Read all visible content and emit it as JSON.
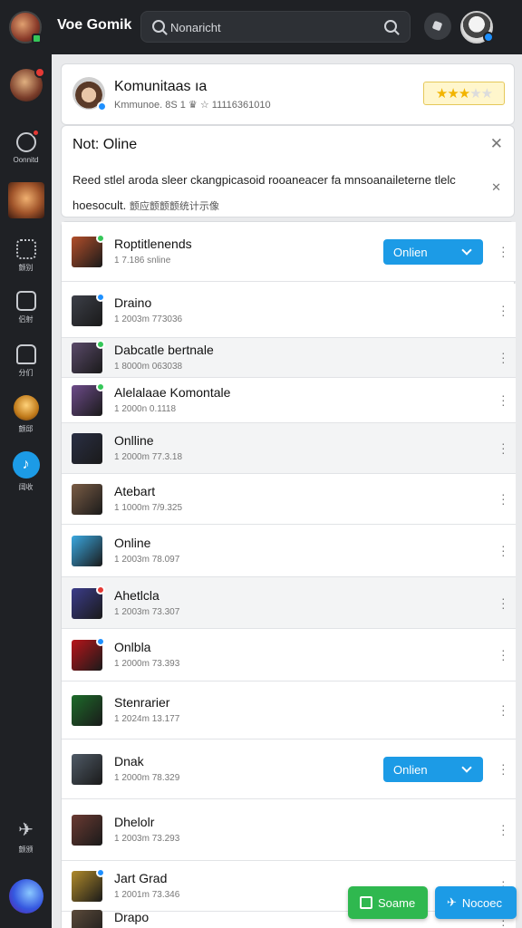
{
  "app": {
    "title": "Voe Gomik",
    "search_placeholder": "Nonaricht"
  },
  "sidebar": {
    "items": [
      {
        "label": "",
        "icon": "user-avatar",
        "badge": true
      },
      {
        "label": "Oonnitd",
        "icon": "broadcast-icon",
        "badge": true
      },
      {
        "label": "",
        "icon": "game-avatar"
      },
      {
        "label": "颤别",
        "icon": "grid-icon"
      },
      {
        "label": "侣射",
        "icon": "chat-box-icon"
      },
      {
        "label": "分们",
        "icon": "tag-icon"
      },
      {
        "label": "颤邱",
        "icon": "shield-avatar"
      },
      {
        "label": "阔收",
        "icon": "tiktok-icon"
      },
      {
        "label": "颤颁",
        "icon": "plane-icon"
      },
      {
        "label": "",
        "icon": "app-swirl-icon"
      }
    ]
  },
  "profile": {
    "name": "Komunitaas ıa",
    "subtitle": "Kmmunoe. 8S 1 ♛ ☆ 11116361010",
    "rating": 3.5
  },
  "notice": {
    "title": "Not: Oline",
    "body_line1": "Reed stlel aroda sleer ckangpicasoid rooaneacer fa mnsoanaileterne tlelc",
    "body_line2": "hoesocult.",
    "body_line2_cjk": "颤应颤颤颤统计示像"
  },
  "rows": [
    {
      "title": "Roptitlenends",
      "subtitle": "1 7.186 snline",
      "button": "Onlien",
      "color": "#b24e2a",
      "dot": "#35c759"
    },
    {
      "title": "Draino",
      "subtitle": "1 2003m 773036",
      "color": "#3c3f48",
      "dot": "#1e90ff"
    },
    {
      "title": "Dabcatle bertnale",
      "subtitle": "1 8000m 063038",
      "color": "#5a4a6a",
      "dot": "#35c759"
    },
    {
      "title": "Alelalaae Komontale",
      "subtitle": "1 2000n 0.1118",
      "color": "#6d4b8a",
      "dot": "#35c759"
    },
    {
      "title": "Onlline",
      "subtitle": "1 2000m 77.3.18",
      "color": "#2a2f44"
    },
    {
      "title": "Atebart",
      "subtitle": "1 1000m 7/9.325",
      "color": "#7a5c45"
    },
    {
      "title": "Online",
      "subtitle": "1 2003m 78.097",
      "color": "#3aa8e0"
    },
    {
      "title": "Ahetlcla",
      "subtitle": "1 2003m 73.307",
      "color": "#3b3c8a",
      "dot": "#e53935"
    },
    {
      "title": "Onlbla",
      "subtitle": "1 2000m 73.393",
      "color": "#b8151a",
      "dot": "#1e90ff"
    },
    {
      "title": "Stenrarier",
      "subtitle": "1 2024m 13.177",
      "color": "#1d6b2a"
    },
    {
      "title": "Dnak",
      "subtitle": "1 2000m 78.329",
      "button": "Onlien",
      "color": "#4f5a66"
    },
    {
      "title": "Dhelolr",
      "subtitle": "1 2003m 73.293",
      "color": "#6a3a32"
    },
    {
      "title": "Jart Grad",
      "subtitle": "1 2001m 73.346",
      "color": "#b08a2a",
      "dot": "#1e90ff"
    },
    {
      "title": "Drapo",
      "subtitle": "",
      "color": "#5b4a3a"
    }
  ],
  "fabs": {
    "green_label": "Soame",
    "blue_label": "Nocoec"
  },
  "colors": {
    "accent": "#1c9be6",
    "green": "#35c759",
    "dark": "#1f2125"
  }
}
